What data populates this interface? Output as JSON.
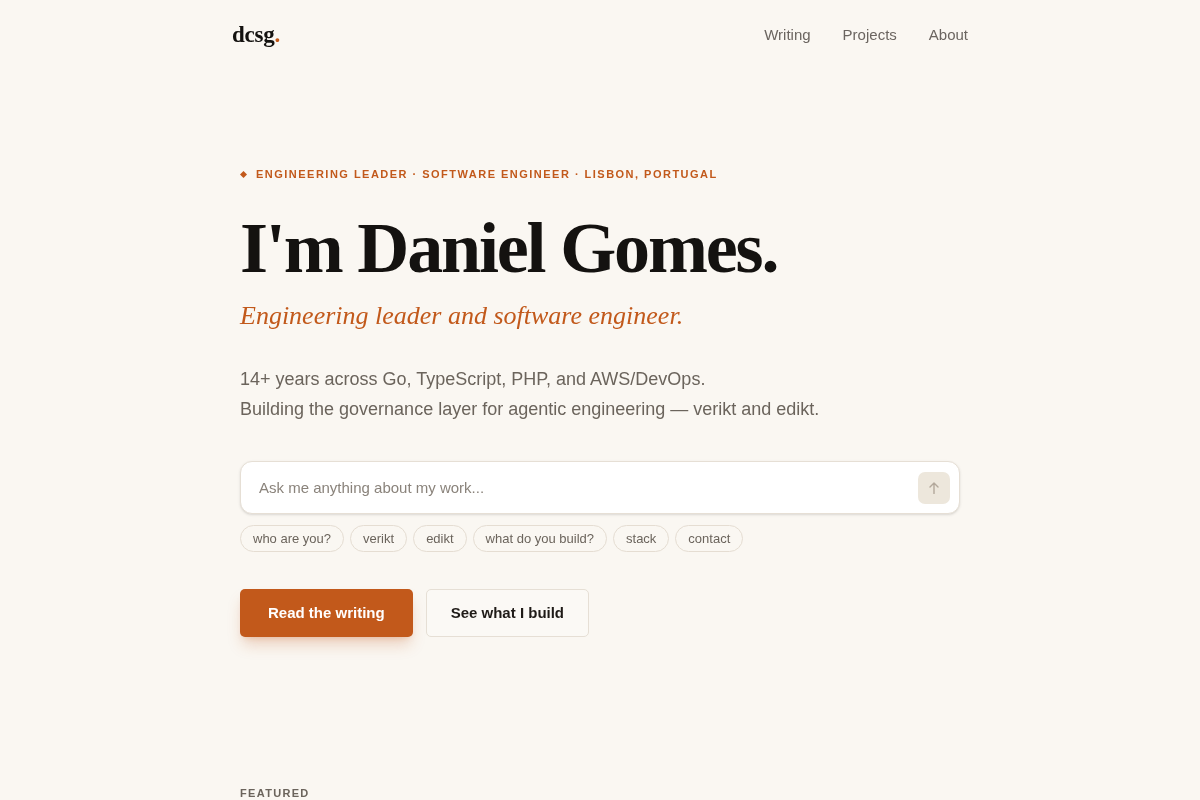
{
  "header": {
    "logo": {
      "text": "dcsg",
      "dot": "."
    },
    "nav": [
      "Writing",
      "Projects",
      "About"
    ]
  },
  "hero": {
    "eyebrow": "ENGINEERING LEADER · SOFTWARE ENGINEER · LISBON, PORTUGAL",
    "title": "I'm Daniel Gomes.",
    "tagline": "Engineering leader and software engineer.",
    "intro": [
      "14+ years across Go, TypeScript, PHP, and AWS/DevOps.",
      "Building the governance layer for agentic engineering — verikt and edikt."
    ]
  },
  "ask": {
    "placeholder": "Ask me anything about my work...",
    "suggestions": [
      "who are you?",
      "verikt",
      "edikt",
      "what do you build?",
      "stack",
      "contact"
    ]
  },
  "actions": [
    {
      "label": "Read the writing",
      "kind": "primary"
    },
    {
      "label": "See what I build",
      "kind": "secondary"
    }
  ],
  "featured": {
    "heading": "FEATURED"
  }
}
